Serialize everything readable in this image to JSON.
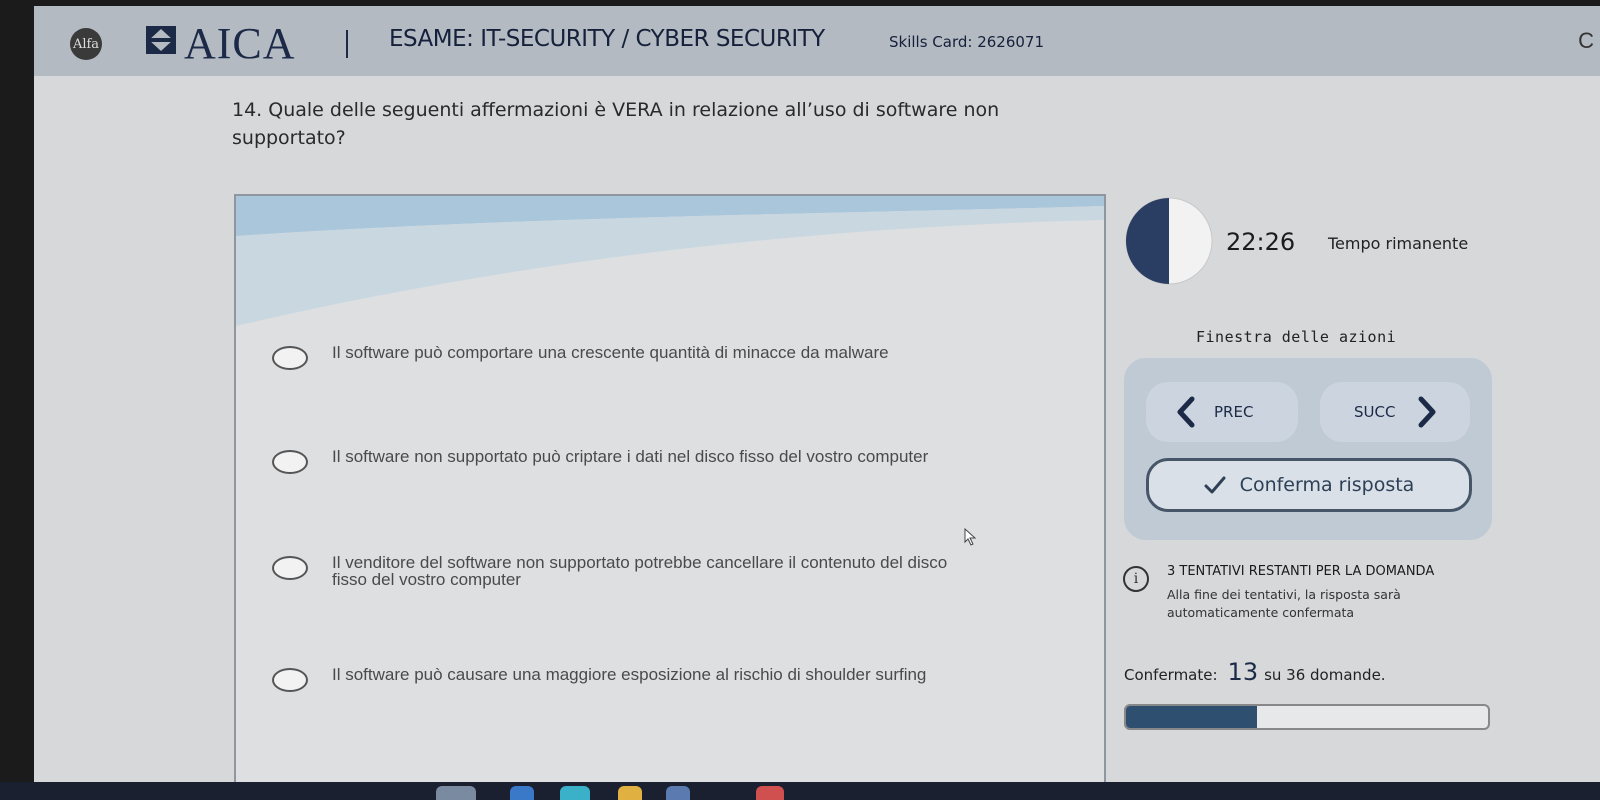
{
  "header": {
    "alfa_logo_text": "Alfa",
    "brand": "AICA",
    "exam_title": "ESAME: IT-SECURITY / CYBER SECURITY",
    "skills_card": "Skills Card: 2626071",
    "right_glyph": "C"
  },
  "question": {
    "text": "14. Quale delle seguenti affermazioni è VERA in relazione all’uso di software non supportato?"
  },
  "answers": [
    {
      "label": "Il software può comportare una crescente quantità di minacce da malware"
    },
    {
      "label": "Il software non supportato può criptare i dati nel disco fisso del vostro computer"
    },
    {
      "label": "Il venditore del software non supportato potrebbe cancellare il contenuto del disco fisso del vostro computer"
    },
    {
      "label": "Il software può causare una maggiore esposizione al rischio di shoulder surfing"
    }
  ],
  "timer": {
    "value": "22:26",
    "label": "Tempo rimanente",
    "remaining_fraction": 0.5
  },
  "actions": {
    "title": "Finestra delle azioni",
    "prev_label": "PREC",
    "next_label": "SUCC",
    "confirm_label": "Conferma risposta"
  },
  "attempts": {
    "title": "3 TENTATIVI RESTANTI PER LA DOMANDA",
    "note": "Alla fine dei tentativi, la risposta sarà automaticamente confermata"
  },
  "progress": {
    "prefix": "Confermate:",
    "confirmed": "13",
    "suffix": "su 36 domande.",
    "fraction": 0.361
  },
  "colors": {
    "accent": "#2f4f70",
    "header_bg": "#b3bac2",
    "brand_text": "#1c2a48"
  },
  "icons": {
    "info": "info-icon",
    "prev": "chevron-left-icon",
    "next": "chevron-right-icon",
    "confirm": "check-icon",
    "timer": "clock-icon"
  }
}
